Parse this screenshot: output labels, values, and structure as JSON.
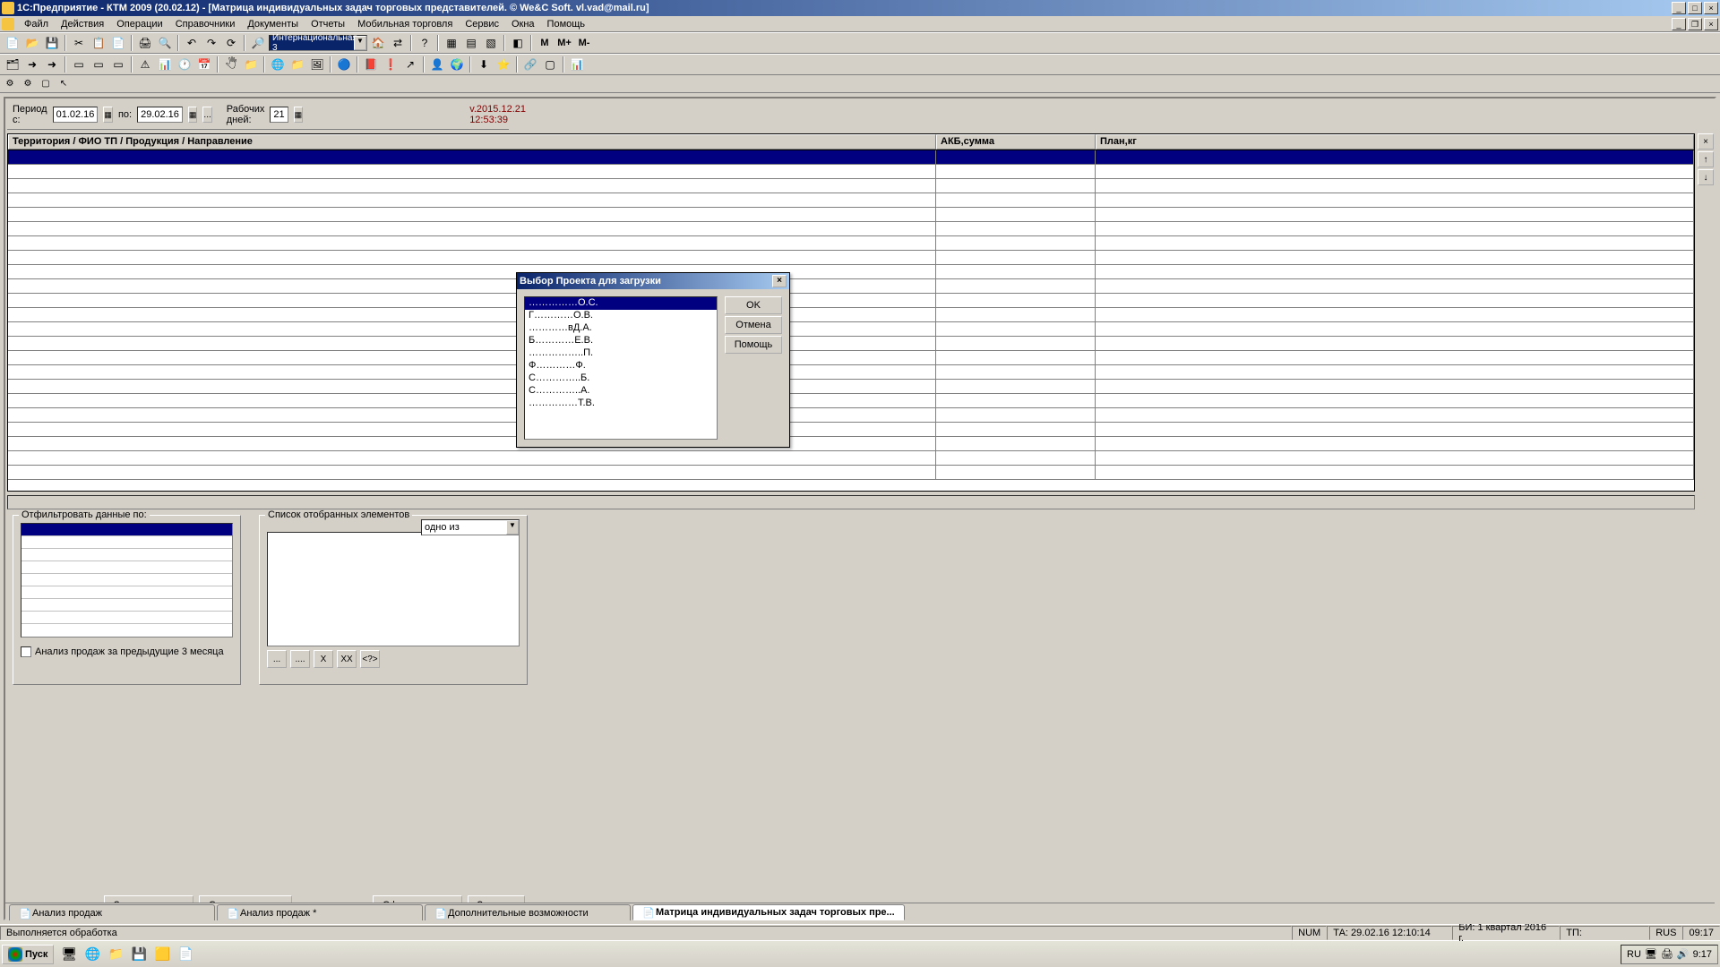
{
  "titlebar": {
    "title": "1С:Предприятие - КТМ 2009 (20.02.12) - [Матрица индивидуальных задач торговых представителей. © We&C Soft. vl.vad@mail.ru]"
  },
  "menu": {
    "file": "Файл",
    "actions": "Действия",
    "operations": "Операции",
    "references": "Справочники",
    "documents": "Документы",
    "reports": "Отчеты",
    "mobile": "Мобильная торговля",
    "service": "Сервис",
    "windows": "Окна",
    "help": "Помощь"
  },
  "toolbar": {
    "combo": "Интернациональная  3",
    "m": "M",
    "mplus": "M+",
    "mminus": "M-"
  },
  "period": {
    "from_label": "Период с:",
    "from": "01.02.16",
    "to_label": "по:",
    "to": "29.02.16",
    "workdays_label": "Рабочих дней:",
    "workdays": "21",
    "version": "v.2015.12.21 12:53:39"
  },
  "grid": {
    "col1": "Территория / ФИО ТП / Продукция / Направление",
    "col2": "АКБ,сумма",
    "col3": "План,кг"
  },
  "filter": {
    "legend": "Отфильтровать данные по:",
    "checkbox": "Анализ продаж за предыдущие 3 месяца"
  },
  "selected": {
    "legend": "Список отобранных элементов",
    "combo": "одно из"
  },
  "buttons": {
    "load_plan": "Загрузить план",
    "save_plan": "Сохранить план",
    "form": "Сформировать",
    "close": "Закрыть"
  },
  "tabs": {
    "t1": "Анализ продаж",
    "t2": "Анализ продаж  *",
    "t3": "Дополнительные возможности",
    "t4": "Матрица индивидуальных задач торговых пре..."
  },
  "status": {
    "msg": "Выполняется обработка",
    "num": "NUM",
    "ta": "ТА: 29.02.16  12:10:14",
    "bi": "БИ: 1 квартал 2016 г.",
    "tp": "ТП:",
    "rus": "RUS",
    "time": "09:17"
  },
  "taskbar": {
    "start": "Пуск",
    "lang": "RU",
    "clock": "9:17"
  },
  "dialog": {
    "title": "Выбор Проекта для загрузки",
    "items": [
      "……………О.С.",
      "Г…………О.В.",
      "…………вД.А.",
      "Б…………Е.В.",
      "……………..П.",
      "Ф…………Ф.",
      "С…………..Б.",
      "С…………..А.",
      "……………Т.В."
    ],
    "ok": "OK",
    "cancel": "Отмена",
    "help": "Помощь"
  },
  "minibtns": {
    "b1": "...",
    "b2": "....",
    "b3": "X",
    "b4": "XX",
    "b5": "<?>"
  }
}
